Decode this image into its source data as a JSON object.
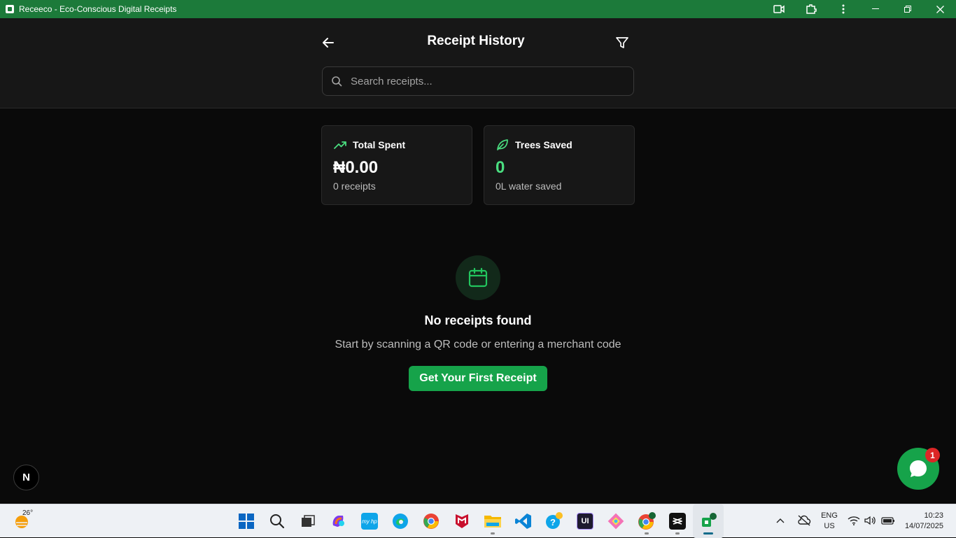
{
  "window": {
    "title": "Receeco - Eco-Conscious Digital Receipts"
  },
  "header": {
    "title": "Receipt History",
    "search_placeholder": "Search receipts..."
  },
  "stats": {
    "total_spent": {
      "label": "Total Spent",
      "value": "₦0.00",
      "sub": "0 receipts"
    },
    "trees_saved": {
      "label": "Trees Saved",
      "value": "0",
      "sub": "0L water saved"
    }
  },
  "empty_state": {
    "title": "No receipts found",
    "description": "Start by scanning a QR code or entering a merchant code",
    "cta_label": "Get Your First Receipt"
  },
  "floating": {
    "next_badge": "N",
    "chat_unread": "1"
  },
  "taskbar": {
    "weather_temp": "26°",
    "apps": [
      "windows-start",
      "search",
      "task-view",
      "copilot",
      "myhp",
      "edge",
      "chrome",
      "mcafee",
      "file-explorer",
      "vscode",
      "help",
      "uipath",
      "git",
      "chrome-profile",
      "capcut",
      "receeco-app"
    ],
    "language": "ENG",
    "region": "US",
    "time": "10:23",
    "date": "14/07/2025"
  },
  "colors": {
    "titlebar": "#1c7a3a",
    "accent": "#16a34a",
    "accent_light": "#4ade80",
    "background": "#0a0a0a",
    "card": "#171717"
  }
}
